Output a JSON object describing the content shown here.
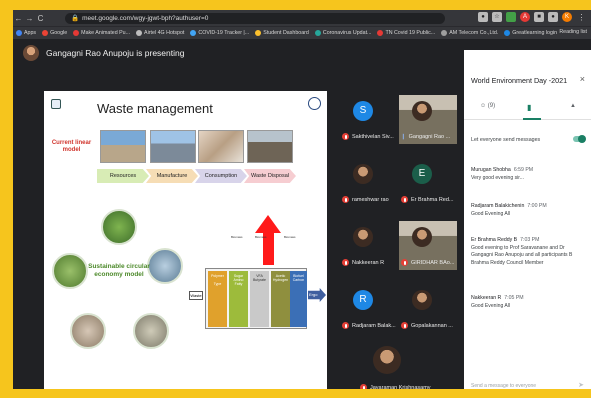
{
  "browser": {
    "url": "meet.google.com/wgy-jgwt-bph?authuser=0",
    "nav_back": "←",
    "nav_forward": "→",
    "nav_reload": "C",
    "bookmarks": [
      {
        "label": "Apps",
        "color": "#4285f4"
      },
      {
        "label": "Google",
        "color": "#ea4335"
      },
      {
        "label": "Make Animated Pu...",
        "color": "#e53935"
      },
      {
        "label": "Airtel 4G Hotspot",
        "color": "#bdbdbd"
      },
      {
        "label": "COVID-19 Tracker |...",
        "color": "#42a5f5"
      },
      {
        "label": "Student Dashboard",
        "color": "#fbc02d"
      },
      {
        "label": "Coronavirus Updat...",
        "color": "#26a69a"
      },
      {
        "label": "TN Covid 19 Public...",
        "color": "#e53935"
      },
      {
        "label": "AM Telecom Co.,Ltd.",
        "color": "#9e9e9e"
      },
      {
        "label": "Greatlearning login",
        "color": "#1e88e5"
      }
    ],
    "reading_list": "Reading list"
  },
  "presenter": {
    "text": "Gangagni Rao Anupoju is presenting"
  },
  "slide": {
    "title": "Waste management",
    "linear_label": "Current linear model",
    "chevrons": [
      "Resources",
      "Manufacture",
      "Consumption",
      "Waste Disposal"
    ],
    "circular_label": "Sustainable circular economy model",
    "waste_label": "Waste",
    "ergo_label": "Ergo"
  },
  "participants": [
    {
      "name": "Sakthivelan Siv...",
      "initial": "S",
      "color": "#1e88e5",
      "muted": true,
      "type": "initial"
    },
    {
      "name": "Gangagni Rao ...",
      "type": "video",
      "muted": false
    },
    {
      "name": "rameshwar rao",
      "type": "photo",
      "muted": true
    },
    {
      "name": "Er Brahma Red...",
      "initial": "E",
      "color": "#1b5e4a",
      "muted": true,
      "type": "initial"
    },
    {
      "name": "Nakkeeran R",
      "type": "photo",
      "muted": true
    },
    {
      "name": "GIRIDHAR BAo...",
      "type": "video",
      "muted": true
    },
    {
      "name": "Radjaram Balak...",
      "initial": "R",
      "color": "#1e88e5",
      "muted": true,
      "type": "initial"
    },
    {
      "name": "Gopalakannan ...",
      "type": "photo",
      "muted": true
    },
    {
      "name": "Jayaraman Krishnasamy",
      "type": "photo",
      "muted": true
    }
  ],
  "panel": {
    "title": "World Environment Day -2021",
    "close": "×",
    "people_count": "(9)",
    "allow_messages": "Let everyone send messages",
    "messages": [
      {
        "sender": "Murugan Shobha",
        "time": "6:59 PM",
        "body": "Very good evening sir..."
      },
      {
        "sender": "Radjaram Balakichenin",
        "time": "7:00 PM",
        "body": "Good Evening All"
      },
      {
        "sender": "Er Brahma Reddy B",
        "time": "7:03 PM",
        "body": "Good evening to Prof Saravanane and Dr Gangagni Rao Anupoju and all participants  B Brahma Reddy Council Member"
      },
      {
        "sender": "Nakkeeran R",
        "time": "7:05 PM",
        "body": "Good Evening All"
      }
    ],
    "send_placeholder": "Send a message to everyone"
  },
  "colors": {
    "outer_border": "#f6c51d",
    "meet_bg": "#202124",
    "accent": "#1a7f64",
    "muted_red": "#e43f36"
  }
}
